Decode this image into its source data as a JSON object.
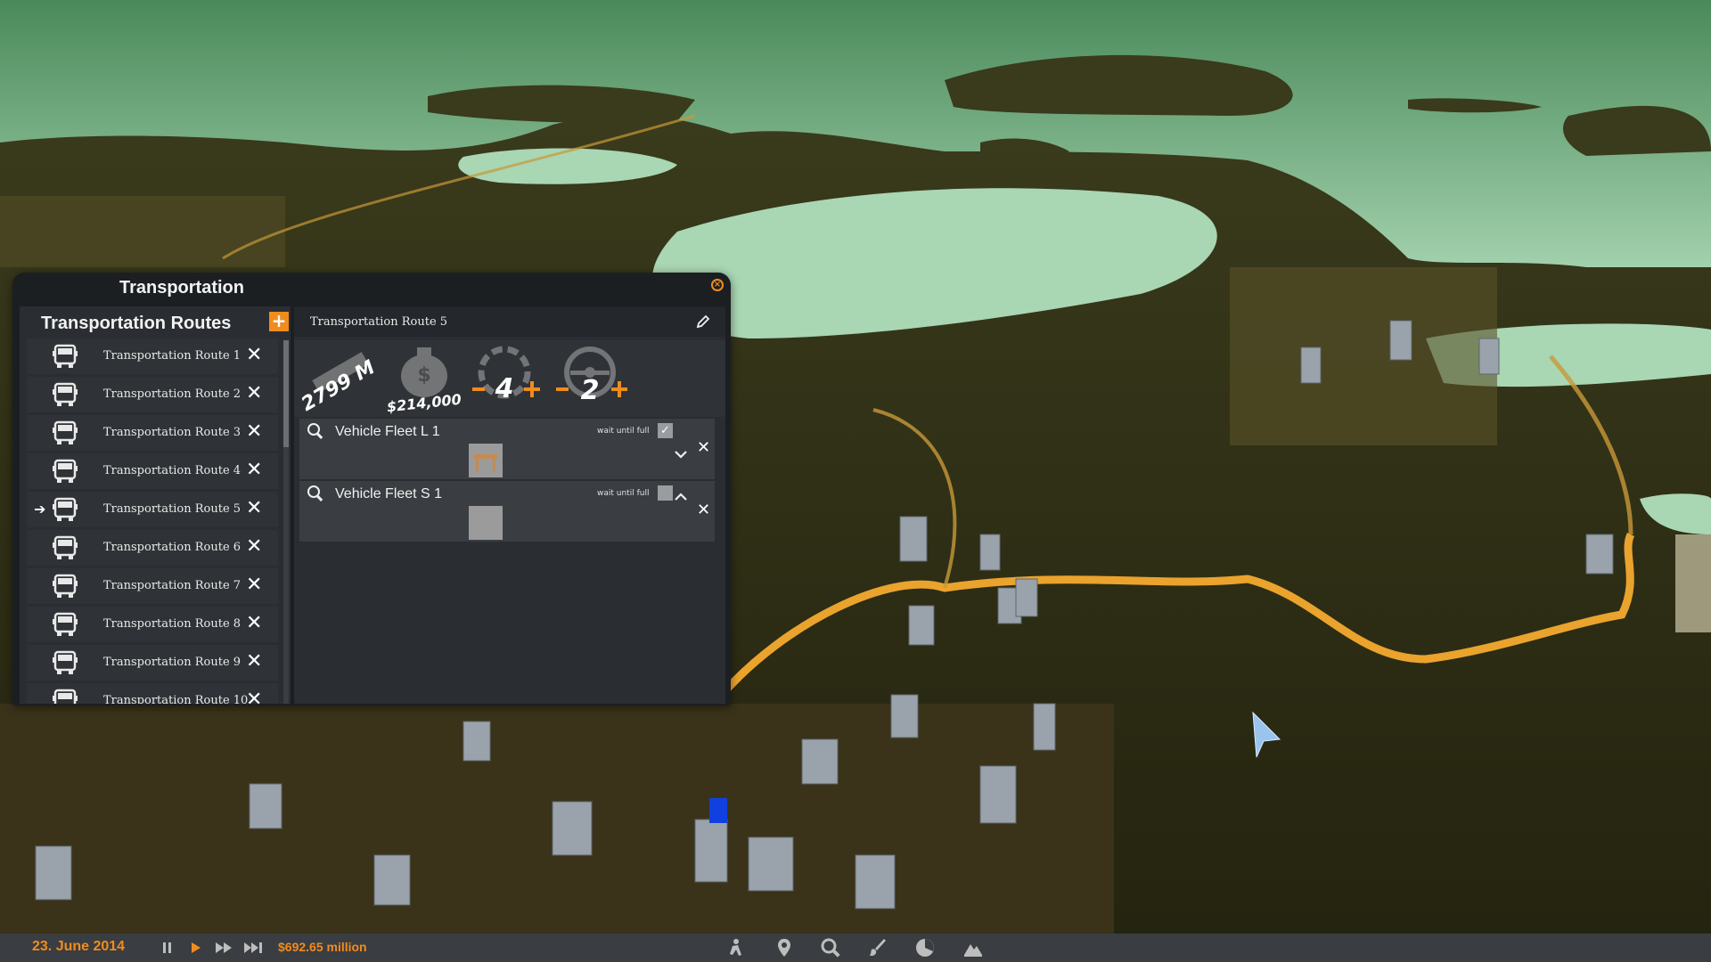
{
  "window": {
    "title": "Transportation"
  },
  "routes_panel": {
    "title": "Transportation Routes",
    "items": [
      {
        "label": "Transportation Route 1",
        "selected": false
      },
      {
        "label": "Transportation Route 2",
        "selected": false
      },
      {
        "label": "Transportation Route 3",
        "selected": false
      },
      {
        "label": "Transportation Route 4",
        "selected": false
      },
      {
        "label": "Transportation Route 5",
        "selected": true
      },
      {
        "label": "Transportation Route 6",
        "selected": false
      },
      {
        "label": "Transportation Route 7",
        "selected": false
      },
      {
        "label": "Transportation Route 8",
        "selected": false
      },
      {
        "label": "Transportation Route 9",
        "selected": false
      },
      {
        "label": "Transportation Route 10",
        "selected": false
      }
    ]
  },
  "route_detail": {
    "name": "Transportation Route 5",
    "length": "2799 M",
    "cost": "$214,000",
    "stops_count": "4",
    "vehicles_count": "2"
  },
  "fleets": [
    {
      "name": "Vehicle Fleet L 1",
      "wait_label": "wait until full",
      "wait_checked": true,
      "chevron": "down"
    },
    {
      "name": "Vehicle Fleet S 1",
      "wait_label": "wait until full",
      "wait_checked": false,
      "chevron": "up"
    }
  ],
  "status_bar": {
    "date": "23. June 2014",
    "money": "$692.65 million"
  },
  "colors": {
    "accent": "#f08c1e",
    "panel": "#2a2d31",
    "water": "#a9d6b3",
    "terrain": "#3b3a1e"
  }
}
